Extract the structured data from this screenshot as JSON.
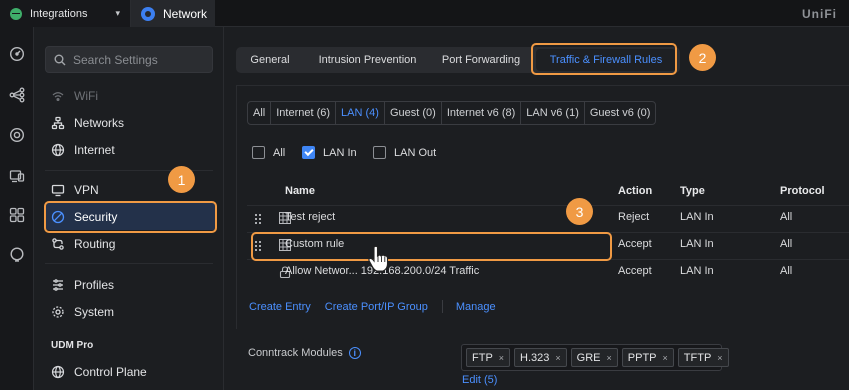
{
  "topbar": {
    "workspace_label": "Integrations",
    "app_label": "Network",
    "brand": "UniFi"
  },
  "rail": {
    "icons": [
      "dashboard-icon",
      "topology-icon",
      "devices-icon",
      "clients-icon",
      "insights-icon",
      "alerts-icon"
    ]
  },
  "sidebar": {
    "search_placeholder": "Search Settings",
    "items": [
      {
        "label": "WiFi",
        "icon": "wifi-icon"
      },
      {
        "label": "Networks",
        "icon": "networks-icon"
      },
      {
        "label": "Internet",
        "icon": "globe-icon"
      },
      {
        "label": "VPN",
        "icon": "vpn-icon"
      },
      {
        "label": "Security",
        "icon": "shield-icon"
      },
      {
        "label": "Routing",
        "icon": "routing-icon"
      },
      {
        "label": "Profiles",
        "icon": "profiles-icon"
      },
      {
        "label": "System",
        "icon": "gear-icon"
      },
      {
        "label": "Control Plane",
        "icon": "control-plane-icon"
      }
    ],
    "section_title": "UDM Pro"
  },
  "main": {
    "tabs": [
      {
        "label": "General"
      },
      {
        "label": "Intrusion Prevention"
      },
      {
        "label": "Port Forwarding"
      },
      {
        "label": "Traffic & Firewall Rules"
      }
    ],
    "filters": [
      {
        "label": "All"
      },
      {
        "label": "Internet (6)"
      },
      {
        "label": "LAN (4)"
      },
      {
        "label": "Guest (0)"
      },
      {
        "label": "Internet v6 (8)"
      },
      {
        "label": "LAN v6 (1)"
      },
      {
        "label": "Guest v6 (0)"
      }
    ],
    "checkboxes": [
      {
        "label": "All",
        "checked": false
      },
      {
        "label": "LAN In",
        "checked": true
      },
      {
        "label": "LAN Out",
        "checked": false
      }
    ],
    "table": {
      "headers": [
        "Name",
        "Action",
        "Type",
        "Protocol"
      ],
      "rows": [
        {
          "name": "Test reject",
          "action": "Reject",
          "type": "LAN In",
          "protocol": "All"
        },
        {
          "name": "Custom rule",
          "action": "Accept",
          "type": "LAN In",
          "protocol": "All"
        },
        {
          "name": "Allow Networ... 192.168.200.0/24 Traffic",
          "action": "Accept",
          "type": "LAN In",
          "protocol": "All"
        }
      ]
    },
    "links": {
      "create_entry": "Create Entry",
      "create_group": "Create Port/IP Group",
      "manage": "Manage"
    },
    "conntrack": {
      "label": "Conntrack Modules",
      "info": "i",
      "tags": [
        "FTP",
        "H.323",
        "GRE",
        "PPTP",
        "TFTP"
      ],
      "remove_glyph": "×",
      "edit_label": "Edit (5)"
    }
  },
  "annotations": [
    "1",
    "2",
    "3"
  ],
  "colors": {
    "accent": "#4b90ff",
    "annotation": "#f09a44",
    "background": "#1c1e21"
  }
}
